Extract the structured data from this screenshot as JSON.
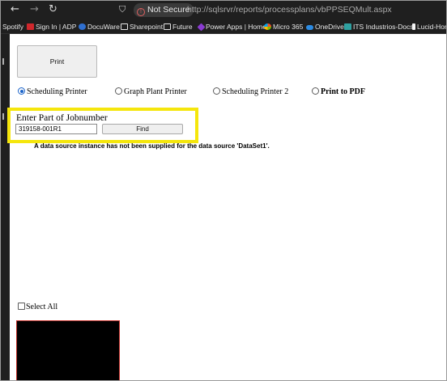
{
  "browser": {
    "nav_back": "←",
    "nav_forward": "→",
    "nav_reload": "↻",
    "security_label": "Not Secure",
    "url": "http://sqlsrvr/reports/processplans/vbPPSEQMult.aspx"
  },
  "bookmarks": [
    {
      "label": "Spotify",
      "icon": "none"
    },
    {
      "label": "Sign In | ADP",
      "icon": "adp-icon"
    },
    {
      "label": "DocuWare",
      "icon": "docuware-icon"
    },
    {
      "label": "Sharepoint",
      "icon": "folder-icon"
    },
    {
      "label": "Future",
      "icon": "folder-icon"
    },
    {
      "label": "Power Apps | Home",
      "icon": "power-apps-icon"
    },
    {
      "label": "Micro 365",
      "icon": "microsoft-365-icon"
    },
    {
      "label": "OneDrive",
      "icon": "onedrive-icon"
    },
    {
      "label": "ITS Industrios-Docs",
      "icon": "its-icon"
    },
    {
      "label": "Lucid-Hom",
      "icon": "lucid-icon"
    }
  ],
  "page": {
    "print_button": "Print",
    "printers": [
      {
        "label": "Scheduling Printer",
        "checked": true
      },
      {
        "label": "Graph Plant Printer",
        "checked": false
      },
      {
        "label": "Scheduling Printer 2",
        "checked": false
      },
      {
        "label": "Print to PDF",
        "checked": false
      }
    ],
    "job_label": "Enter Part of Jobnumber",
    "job_value": "319158-001R1",
    "find_button": "Find",
    "data_source_error": "A data source instance has not been supplied for the data source 'DataSet1'.",
    "select_all_label": "Select All"
  },
  "colors": {
    "highlight": "#f5e60c",
    "browser_chrome": "#1f1f1f",
    "radio_accent": "#1a63c9"
  }
}
